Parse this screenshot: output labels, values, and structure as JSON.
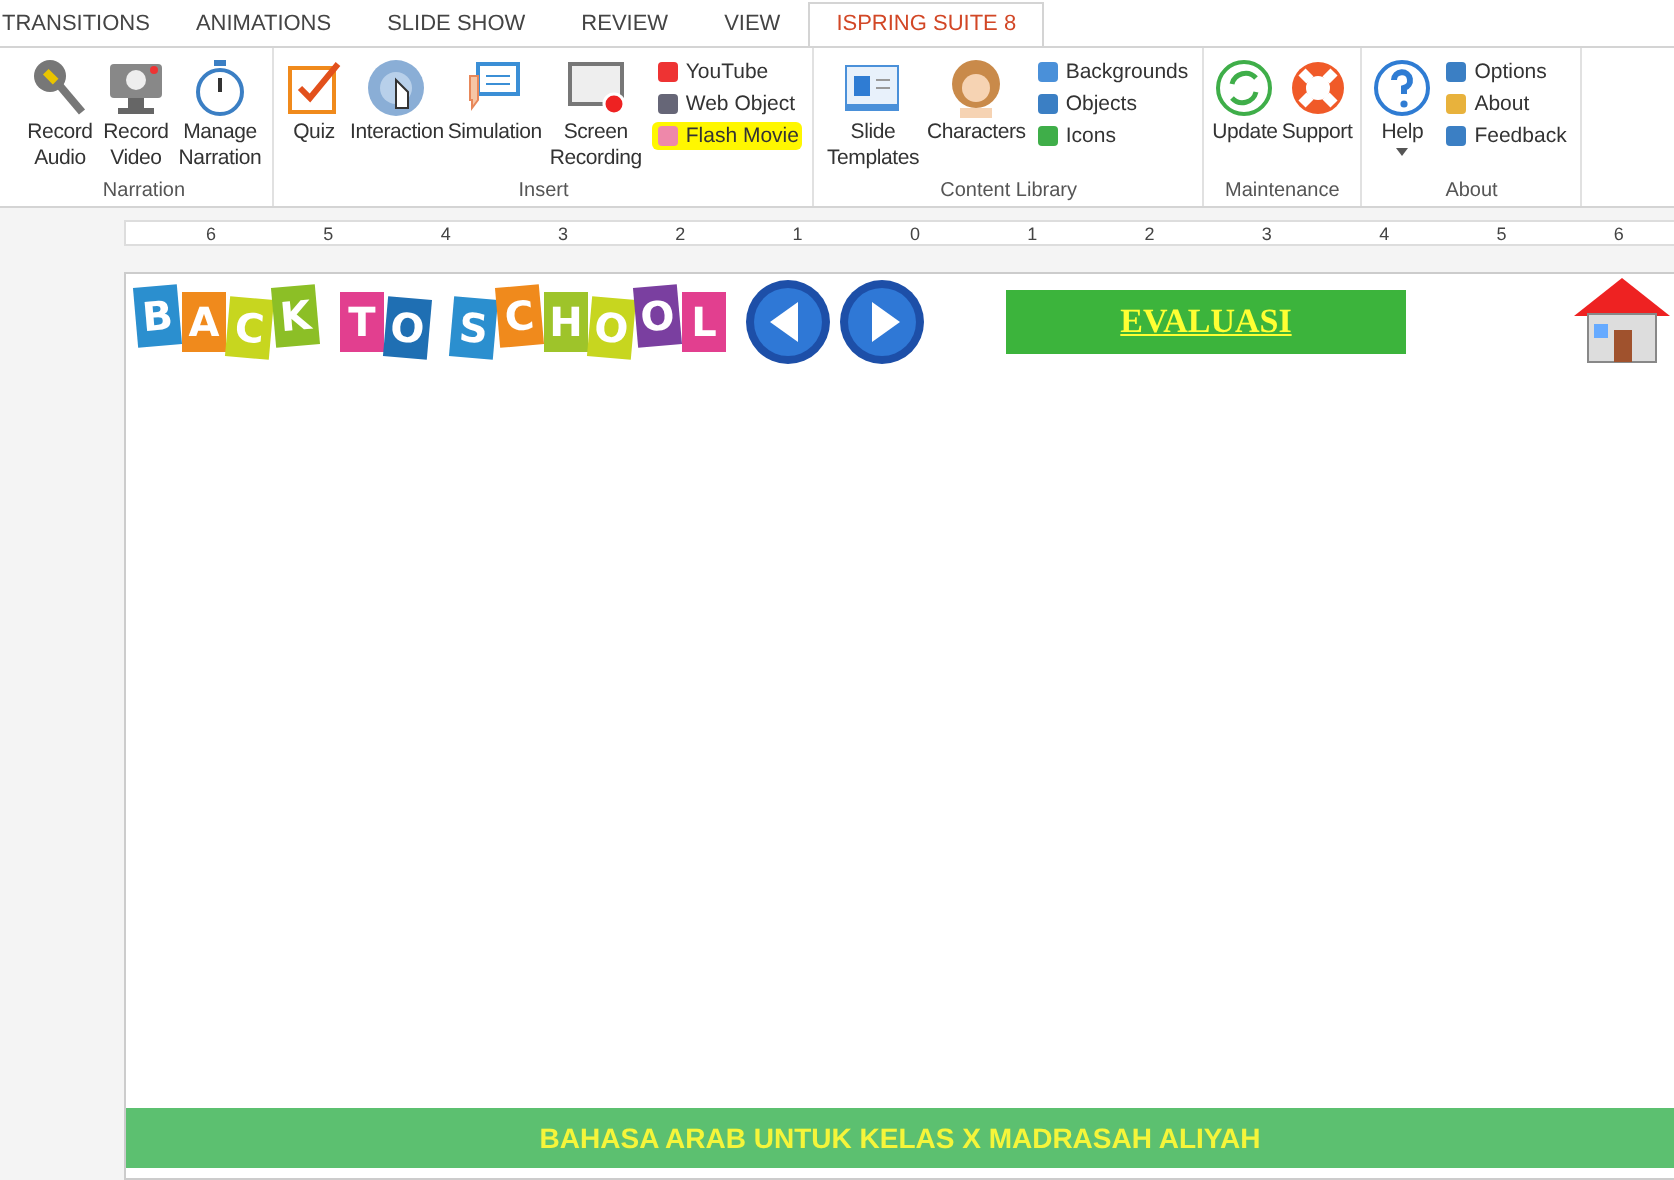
{
  "tabs": [
    {
      "label": "TRANSITIONS",
      "selected": false
    },
    {
      "label": "ANIMATIONS",
      "selected": false
    },
    {
      "label": "SLIDE SHOW",
      "selected": false
    },
    {
      "label": "REVIEW",
      "selected": false
    },
    {
      "label": "VIEW",
      "selected": false
    },
    {
      "label": "ISPRING SUITE 8",
      "selected": true
    }
  ],
  "ribbon_groups": [
    {
      "title": "Narration",
      "items": [
        {
          "kind": "large",
          "label": "Record Audio"
        },
        {
          "kind": "large",
          "label": "Record Video"
        },
        {
          "kind": "large",
          "label": "Manage Narration"
        }
      ]
    },
    {
      "title": "Insert",
      "items": [
        {
          "kind": "large",
          "label": "Quiz"
        },
        {
          "kind": "large",
          "label": "Interaction"
        },
        {
          "kind": "large",
          "label": "Simulation"
        },
        {
          "kind": "large",
          "label": "Screen Recording"
        },
        {
          "kind": "stack",
          "items": [
            {
              "label": "YouTube",
              "highlighted": false
            },
            {
              "label": "Web Object",
              "highlighted": false
            },
            {
              "label": "Flash Movie",
              "highlighted": true
            }
          ]
        }
      ]
    },
    {
      "title": "Content Library",
      "items": [
        {
          "kind": "large",
          "label": "Slide Templates"
        },
        {
          "kind": "large",
          "label": "Characters"
        },
        {
          "kind": "stack",
          "items": [
            {
              "label": "Backgrounds",
              "highlighted": false
            },
            {
              "label": "Objects",
              "highlighted": false
            },
            {
              "label": "Icons",
              "highlighted": false
            }
          ]
        }
      ]
    },
    {
      "title": "Maintenance",
      "items": [
        {
          "kind": "large",
          "label": "Update"
        },
        {
          "kind": "large",
          "label": "Support"
        }
      ]
    },
    {
      "title": "About",
      "items": [
        {
          "kind": "large",
          "label": "Help",
          "dropdown": true
        },
        {
          "kind": "stack",
          "items": [
            {
              "label": "Options",
              "highlighted": false
            },
            {
              "label": "About",
              "highlighted": false
            },
            {
              "label": "Feedback",
              "highlighted": false
            }
          ]
        }
      ]
    }
  ],
  "ruler": [
    "6",
    "5",
    "4",
    "3",
    "2",
    "1",
    "0",
    "1",
    "2",
    "3",
    "4",
    "5",
    "6"
  ],
  "slide": {
    "logo_words": [
      [
        {
          "letter": "B",
          "color": "#2b8fcf"
        },
        {
          "letter": "A",
          "color": "#f08a1c"
        },
        {
          "letter": "C",
          "color": "#c7d61f"
        },
        {
          "letter": "K",
          "color": "#8cbf26"
        }
      ],
      [
        {
          "letter": "T",
          "color": "#e23f8f"
        },
        {
          "letter": "O",
          "color": "#1f6fb3"
        }
      ],
      [
        {
          "letter": "S",
          "color": "#2b8fcf"
        },
        {
          "letter": "C",
          "color": "#f08a1c"
        },
        {
          "letter": "H",
          "color": "#9ec42a"
        },
        {
          "letter": "O",
          "color": "#c7d61f"
        },
        {
          "letter": "O",
          "color": "#7a3fa0"
        },
        {
          "letter": "L",
          "color": "#e23f8f"
        }
      ]
    ],
    "evaluation_button": "EVALUASI",
    "footer": "BAHASA ARAB UNTUK KELAS X MADRASAH ALIYAH"
  }
}
